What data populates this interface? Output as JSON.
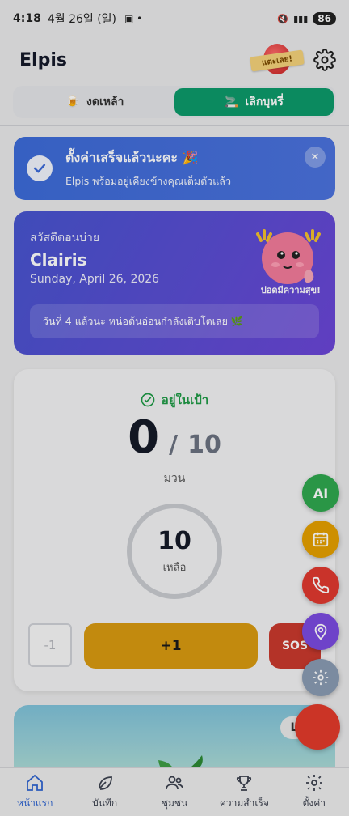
{
  "status_bar": {
    "time": "4:18",
    "date": "4월 26일 (일)",
    "battery": "86"
  },
  "header": {
    "logo": "Elpis",
    "pet_badge_label": "แตะเลย!"
  },
  "mode_toggle": {
    "tabs": [
      {
        "label": "งดเหล้า",
        "emoji": "🍺",
        "active": false
      },
      {
        "label": "เลิกบุหรี่",
        "emoji": "🚬",
        "active": true
      }
    ]
  },
  "toast": {
    "title": "ตั้งค่าเสร็จแล้วนะคะ 🎉",
    "subtitle": "Elpis พร้อมอยู่เคียงข้างคุณเต็มตัวแล้ว"
  },
  "greeting": {
    "hello": "สวัสดีตอนบ่าย",
    "name": "Clairis",
    "date": "Sunday, April 26, 2026",
    "mascot_caption": "ปอดมีความสุข!",
    "streak_message": "วันที่ 4 แล้วนะ หน่อต้นอ่อนกำลังเติบโตเลย 🌿"
  },
  "counter": {
    "status_label": "อยู่ในเป้า",
    "count": "0",
    "limit": "10",
    "slash": "/",
    "unit": "มวน",
    "remaining_value": "10",
    "remaining_label": "เหลือ",
    "minus_label": "-1",
    "plus_label": "+1",
    "sos_label": "SOS"
  },
  "plant_card": {
    "badge": "L"
  },
  "fabs": {
    "ai_label": "AI"
  },
  "bottom_nav": [
    {
      "label": "หน้าแรก",
      "icon": "home-icon",
      "active": true
    },
    {
      "label": "บันทึก",
      "icon": "leaf-icon",
      "active": false
    },
    {
      "label": "ชุมชน",
      "icon": "users-icon",
      "active": false
    },
    {
      "label": "ความสำเร็จ",
      "icon": "trophy-icon",
      "active": false
    },
    {
      "label": "ตั้งค่า",
      "icon": "gear-icon",
      "active": false
    }
  ],
  "colors": {
    "active_tab": "#0d9a6a",
    "toast_bg": "#3d6bd8",
    "greeting_bg": "#5a4bd3",
    "goal_green": "#1f9a46",
    "plus_button": "#d99a10",
    "sos_button": "#c9392d",
    "nav_active": "#3065d1"
  }
}
